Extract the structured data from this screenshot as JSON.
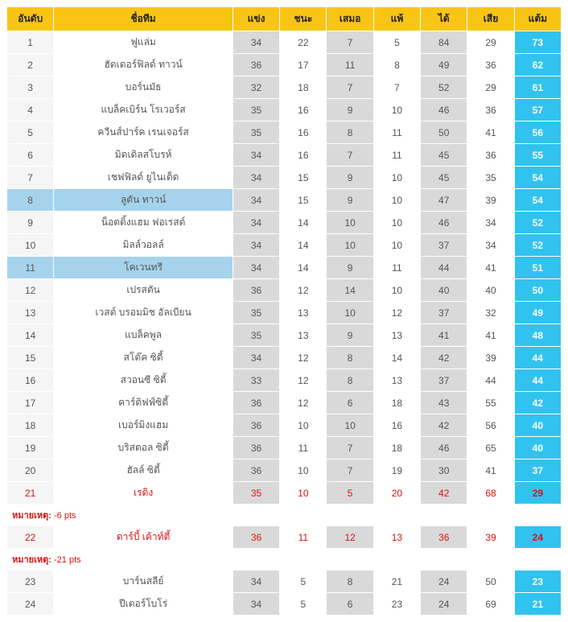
{
  "headers": {
    "rank": "อันดับ",
    "team": "ชื่อทีม",
    "played": "แข่ง",
    "won": "ชนะ",
    "drawn": "เสมอ",
    "lost": "แพ้",
    "gf": "ได้",
    "ga": "เสีย",
    "pts": "แต้ม"
  },
  "note_label": "หมายเหตุ:",
  "rows": [
    {
      "rank": "1",
      "team": "ฟูแล่ม",
      "p": "34",
      "w": "22",
      "d": "7",
      "l": "5",
      "gf": "84",
      "ga": "29",
      "pts": "73"
    },
    {
      "rank": "2",
      "team": "ฮัดเดอร์ฟิลด์ ทาวน์",
      "p": "36",
      "w": "17",
      "d": "11",
      "l": "8",
      "gf": "49",
      "ga": "36",
      "pts": "62"
    },
    {
      "rank": "3",
      "team": "บอร์นมัธ",
      "p": "32",
      "w": "18",
      "d": "7",
      "l": "7",
      "gf": "52",
      "ga": "29",
      "pts": "61"
    },
    {
      "rank": "4",
      "team": "แบล็คเบิร์น โรเวอร์ส",
      "p": "35",
      "w": "16",
      "d": "9",
      "l": "10",
      "gf": "46",
      "ga": "36",
      "pts": "57"
    },
    {
      "rank": "5",
      "team": "ควีนส์ปาร์ค เรนเจอร์ส",
      "p": "35",
      "w": "16",
      "d": "8",
      "l": "11",
      "gf": "50",
      "ga": "41",
      "pts": "56"
    },
    {
      "rank": "6",
      "team": "มิดเดิลสโบรห์",
      "p": "34",
      "w": "16",
      "d": "7",
      "l": "11",
      "gf": "45",
      "ga": "36",
      "pts": "55"
    },
    {
      "rank": "7",
      "team": "เชฟฟิลด์ ยูไนเต็ด",
      "p": "34",
      "w": "15",
      "d": "9",
      "l": "10",
      "gf": "45",
      "ga": "35",
      "pts": "54"
    },
    {
      "rank": "8",
      "team": "ลูตัน ทาวน์",
      "p": "34",
      "w": "15",
      "d": "9",
      "l": "10",
      "gf": "47",
      "ga": "39",
      "pts": "54",
      "hl": true
    },
    {
      "rank": "9",
      "team": "น็อตติ้งแฮม ฟอเรสต์",
      "p": "34",
      "w": "14",
      "d": "10",
      "l": "10",
      "gf": "46",
      "ga": "34",
      "pts": "52"
    },
    {
      "rank": "10",
      "team": "มิลล์วอลล์",
      "p": "34",
      "w": "14",
      "d": "10",
      "l": "10",
      "gf": "37",
      "ga": "34",
      "pts": "52"
    },
    {
      "rank": "11",
      "team": "โคเวนทรี",
      "p": "34",
      "w": "14",
      "d": "9",
      "l": "11",
      "gf": "44",
      "ga": "41",
      "pts": "51",
      "hl": true
    },
    {
      "rank": "12",
      "team": "เปรสตัน",
      "p": "36",
      "w": "12",
      "d": "14",
      "l": "10",
      "gf": "40",
      "ga": "40",
      "pts": "50"
    },
    {
      "rank": "13",
      "team": "เวสต์ บรอมมิช อัลเบียน",
      "p": "35",
      "w": "13",
      "d": "10",
      "l": "12",
      "gf": "37",
      "ga": "32",
      "pts": "49"
    },
    {
      "rank": "14",
      "team": "แบล็คพูล",
      "p": "35",
      "w": "13",
      "d": "9",
      "l": "13",
      "gf": "41",
      "ga": "41",
      "pts": "48"
    },
    {
      "rank": "15",
      "team": "สโต๊ค ซิตี้",
      "p": "34",
      "w": "12",
      "d": "8",
      "l": "14",
      "gf": "42",
      "ga": "39",
      "pts": "44"
    },
    {
      "rank": "16",
      "team": "สวอนซี ซิตี้",
      "p": "33",
      "w": "12",
      "d": "8",
      "l": "13",
      "gf": "37",
      "ga": "44",
      "pts": "44"
    },
    {
      "rank": "17",
      "team": "คาร์ดิฟฟ์ซิตี้",
      "p": "36",
      "w": "12",
      "d": "6",
      "l": "18",
      "gf": "43",
      "ga": "55",
      "pts": "42"
    },
    {
      "rank": "18",
      "team": "เบอร์มิงแฮม",
      "p": "36",
      "w": "10",
      "d": "10",
      "l": "16",
      "gf": "42",
      "ga": "56",
      "pts": "40"
    },
    {
      "rank": "19",
      "team": "บริสตอล ซิตี้",
      "p": "36",
      "w": "11",
      "d": "7",
      "l": "18",
      "gf": "46",
      "ga": "65",
      "pts": "40"
    },
    {
      "rank": "20",
      "team": "ฮัลล์ ซิตี้",
      "p": "36",
      "w": "10",
      "d": "7",
      "l": "19",
      "gf": "30",
      "ga": "41",
      "pts": "37"
    },
    {
      "rank": "21",
      "team": "เรดิง",
      "p": "35",
      "w": "10",
      "d": "5",
      "l": "20",
      "gf": "42",
      "ga": "68",
      "pts": "29",
      "red": true
    },
    {
      "note": "-6 pts"
    },
    {
      "rank": "22",
      "team": "ดาร์บี้ เค้าท์ตี้",
      "p": "36",
      "w": "11",
      "d": "12",
      "l": "13",
      "gf": "36",
      "ga": "39",
      "pts": "24",
      "red": true
    },
    {
      "note": "-21 pts"
    },
    {
      "rank": "23",
      "team": "บาร์นสลีย์",
      "p": "34",
      "w": "5",
      "d": "8",
      "l": "21",
      "gf": "24",
      "ga": "50",
      "pts": "23"
    },
    {
      "rank": "24",
      "team": "ปีเตอร์โบโร่",
      "p": "34",
      "w": "5",
      "d": "6",
      "l": "23",
      "gf": "24",
      "ga": "69",
      "pts": "21"
    }
  ]
}
